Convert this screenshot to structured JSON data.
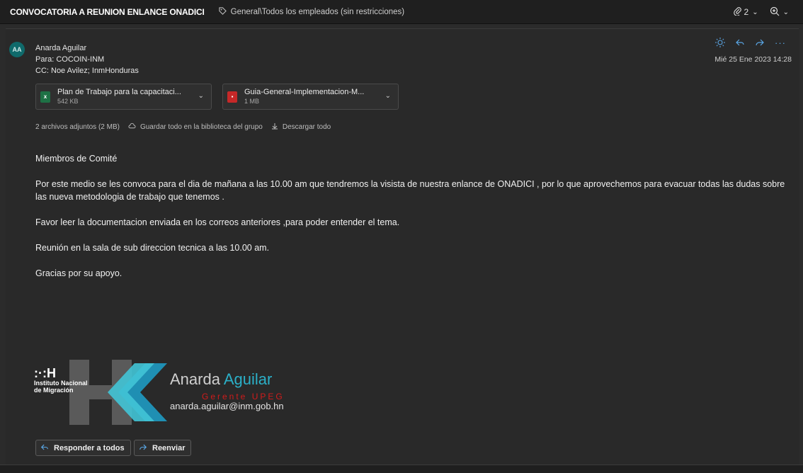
{
  "topbar": {
    "subject": "CONVOCATORIA A REUNION ENLANCE ONADICI",
    "tag_icon": "tag-icon",
    "tag_path": "General\\Todos los empleados (sin restricciones)",
    "attachments_count": "2",
    "zoom_icon": "zoom-icon"
  },
  "message": {
    "sender_initials": "AA",
    "sender_name": "Anarda Aguilar",
    "to": "Para: COCOIN-INM",
    "cc": "CC: Noe Avilez; InmHonduras",
    "date": "Mié 25 Ene 2023 14:28",
    "actions": [
      "sun-icon",
      "reply-icon",
      "forward-icon",
      "more-icon"
    ]
  },
  "attachments": [
    {
      "name": "Plan de Trabajo para la capacitaci...",
      "size": "542 KB",
      "type": "excel",
      "color": "#1e7145"
    },
    {
      "name": "Guia-General-Implementacion-M...",
      "size": "1 MB",
      "type": "pdf",
      "color": "#c62828"
    }
  ],
  "attach_summary": {
    "text": "2 archivos adjuntos (2 MB)",
    "save": "Guardar todo en la biblioteca del grupo",
    "download": "Descargar todo"
  },
  "body": {
    "greeting": "Miembros de Comité",
    "p1": "Por este medio se les convoca para el dia de mañana a las 10.00 am que tendremos la visista de nuestra enlance de ONADICI , por lo que aprovechemos para  evacuar todas las dudas sobre las nueva metodologia de trabajo que tenemos .",
    "p2": "Favor leer la documentacion enviada en los correos anteriores ,para poder entender el tema.",
    "p3": "Reunión en la sala de sub direccion tecnica a las 10.00 am.",
    "p4": "Gracias por su apoyo."
  },
  "signature": {
    "first": "Anarda",
    "last": "Aguilar",
    "role": "Gerente UPEG",
    "email": "anarda.aguilar@inm.gob.hn",
    "inst1": "Instituto Nacional",
    "inst2": "de Migración"
  },
  "buttons": {
    "reply_all": "Responder a todos",
    "forward": "Reenviar"
  },
  "colors": {
    "accent": "#5aa7e6",
    "avatar": "#0f6a6b",
    "brand_teal": "#2bb0c8",
    "brand_red": "#d11b1b"
  }
}
